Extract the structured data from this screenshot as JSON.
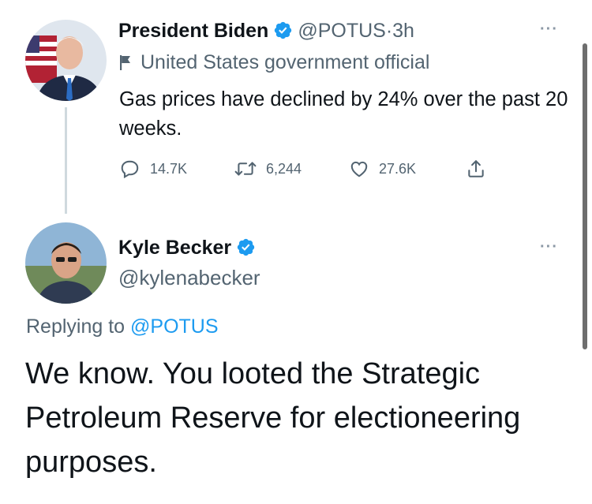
{
  "tweet": {
    "author_name": "President Biden",
    "author_handle": "@POTUS",
    "separator": "·",
    "time": "3h",
    "label": "United States government official",
    "text": "Gas prices have declined by 24% over the past 20 weeks.",
    "more": "···",
    "actions": {
      "reply_count": "",
      "replies": "14.7K",
      "retweets": "6,244",
      "likes": "27.6K"
    }
  },
  "reply": {
    "author_name": "Kyle Becker",
    "author_handle": "@kylenabecker",
    "replying_prefix": "Replying to",
    "replying_to": "@POTUS",
    "text": "We know. You looted the Strategic Petroleum Reserve for electioneering purposes.",
    "more": "···"
  },
  "colors": {
    "accent": "#1d9bf0",
    "text": "#0f1419",
    "secondary": "#536471",
    "thread_line": "#cfd9de"
  },
  "icons": {
    "verified": "verified-badge-icon",
    "label": "flag-icon",
    "reply": "reply-icon",
    "retweet": "retweet-icon",
    "like": "heart-icon",
    "share": "share-icon"
  }
}
